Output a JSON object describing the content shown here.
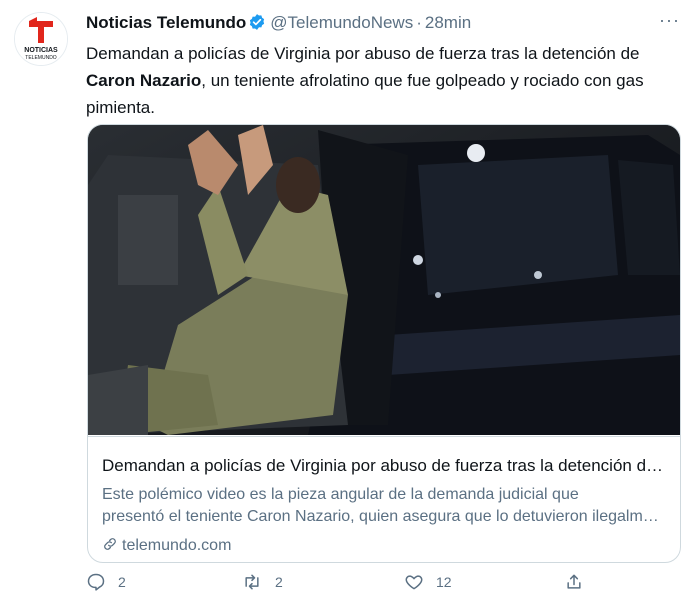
{
  "tweet": {
    "display_name": "Noticias Telemundo",
    "handle": "@TelemundoNews",
    "separator": "·",
    "time": "28min",
    "more_label": "···",
    "text_before": "Demandan a policías de Virginia por abuso de fuerza tras la detención de ",
    "text_bold": "Caron Nazario",
    "text_after": ", un teniente afrolatino que fue golpeado y rociado con gas pimienta."
  },
  "avatar": {
    "line1": "NOTICIAS",
    "line2": "TELEMUNDO",
    "brand_color": "#e1261c"
  },
  "card": {
    "title": "Demandan a policías de Virginia por abuso de fuerza tras la detención de Caron Nazario",
    "description_line1": "Este polémico video es la pieza angular de la demanda judicial que",
    "description_line2": "presentó el teniente Caron Nazario, quien asegura que lo detuvieron ilegalmente",
    "domain": "telemundo.com",
    "image_icon": "photo-of-man-in-uniform-with-raised-hands-in-car"
  },
  "actions": {
    "reply_count": "2",
    "retweet_count": "2",
    "like_count": "12"
  },
  "colors": {
    "verified": "#1d9bf0",
    "muted": "#5b7083",
    "border": "#cfd9de"
  }
}
